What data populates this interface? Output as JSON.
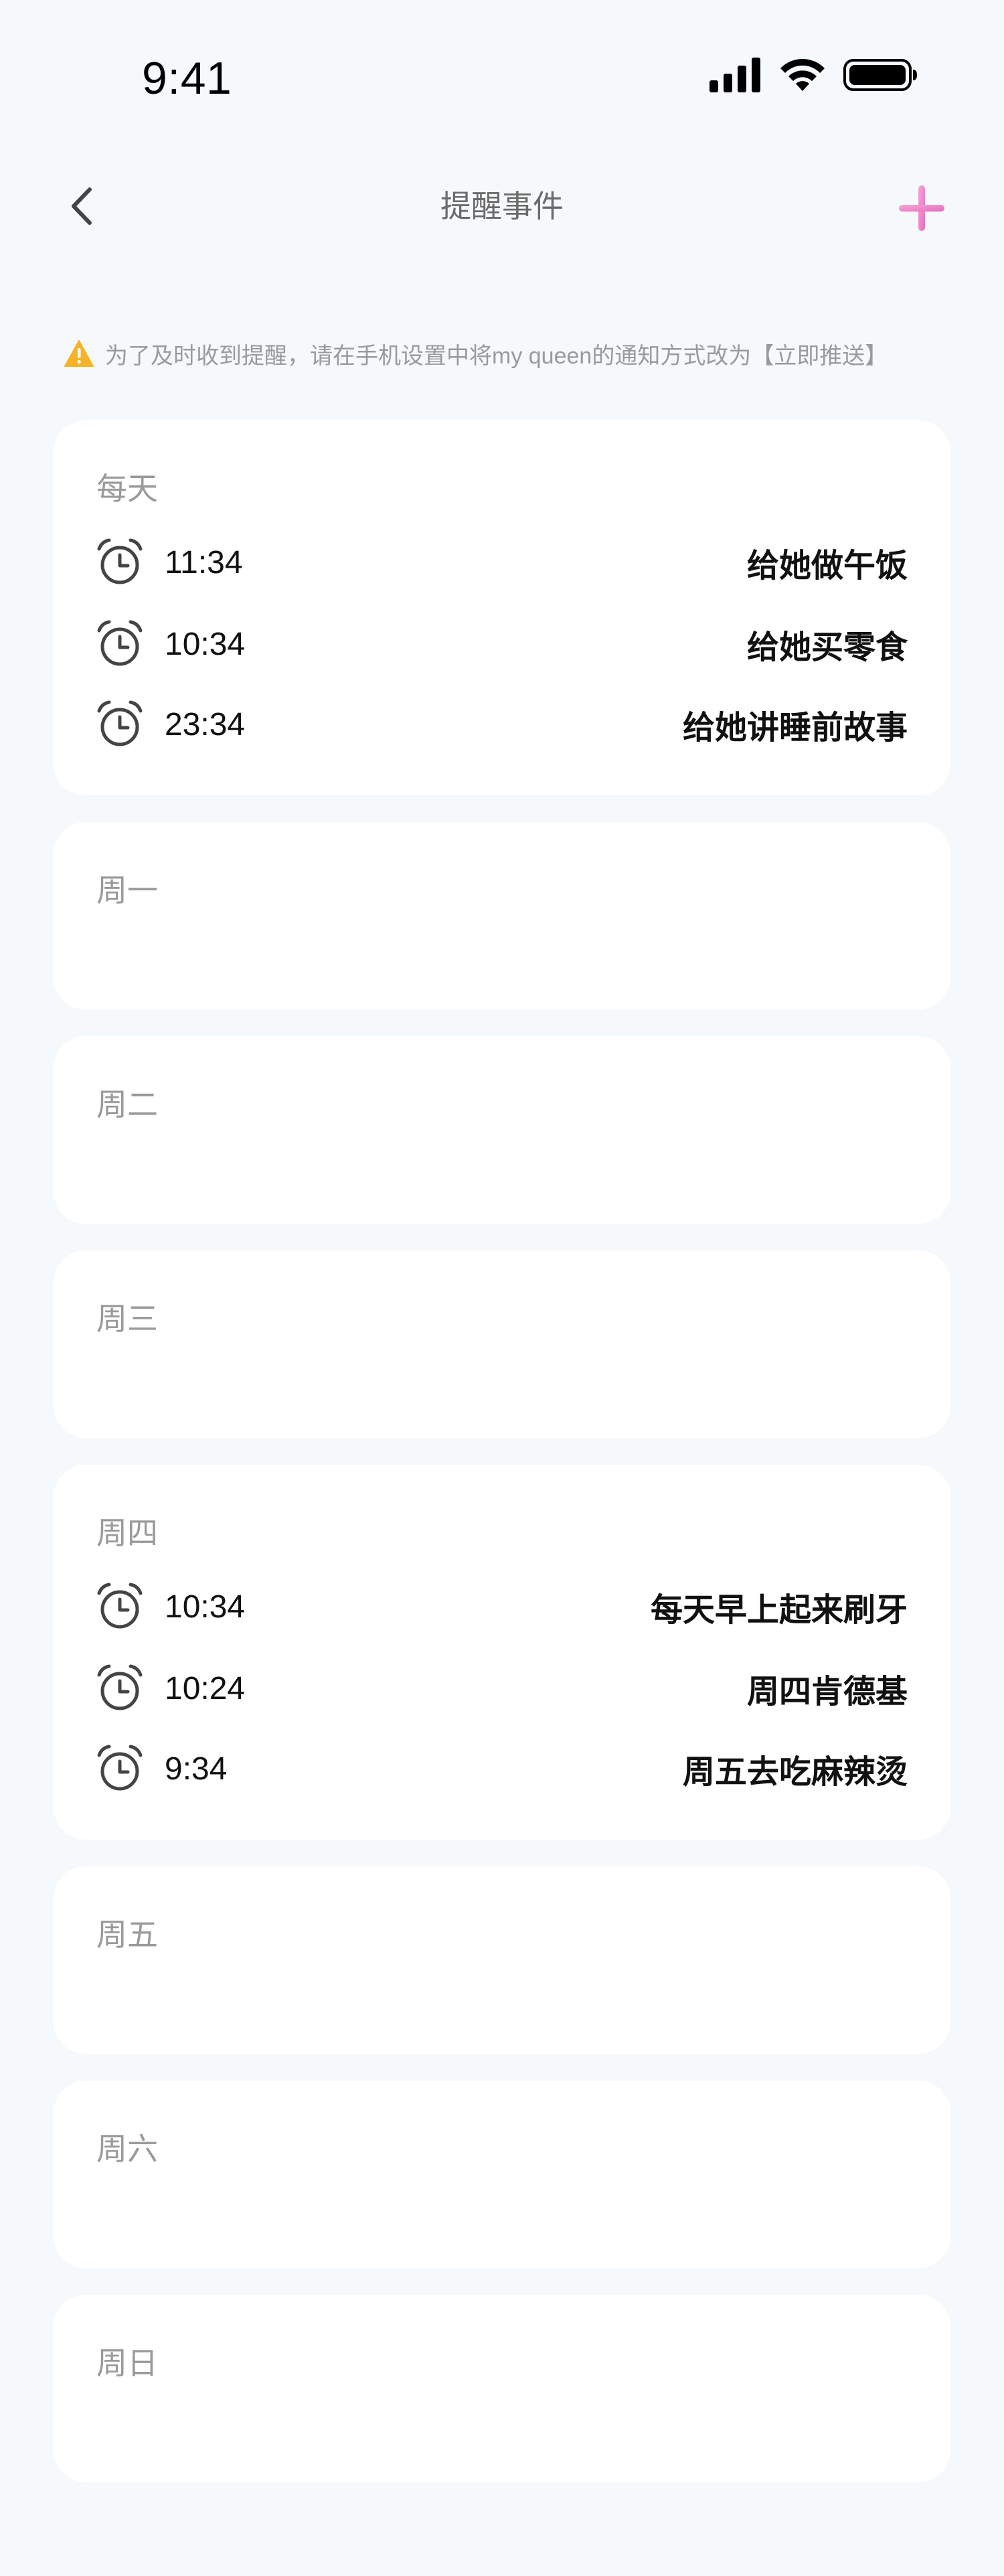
{
  "status_bar": {
    "time": "9:41"
  },
  "nav": {
    "title": "提醒事件"
  },
  "notice": {
    "text": "为了及时收到提醒，请在手机设置中将my queen的通知方式改为【立即推送】"
  },
  "accent_color": "#ee82c8",
  "sections": [
    {
      "title": "每天",
      "items": [
        {
          "time": "11:34",
          "label": "给她做午饭"
        },
        {
          "time": "10:34",
          "label": "给她买零食"
        },
        {
          "time": "23:34",
          "label": "给她讲睡前故事"
        }
      ]
    },
    {
      "title": "周一",
      "items": []
    },
    {
      "title": "周二",
      "items": []
    },
    {
      "title": "周三",
      "items": []
    },
    {
      "title": "周四",
      "items": [
        {
          "time": "10:34",
          "label": "每天早上起来刷牙"
        },
        {
          "time": "10:24",
          "label": "周四肯德基"
        },
        {
          "time": "9:34",
          "label": "周五去吃麻辣烫"
        }
      ]
    },
    {
      "title": "周五",
      "items": []
    },
    {
      "title": "周六",
      "items": []
    },
    {
      "title": "周日",
      "items": []
    }
  ]
}
